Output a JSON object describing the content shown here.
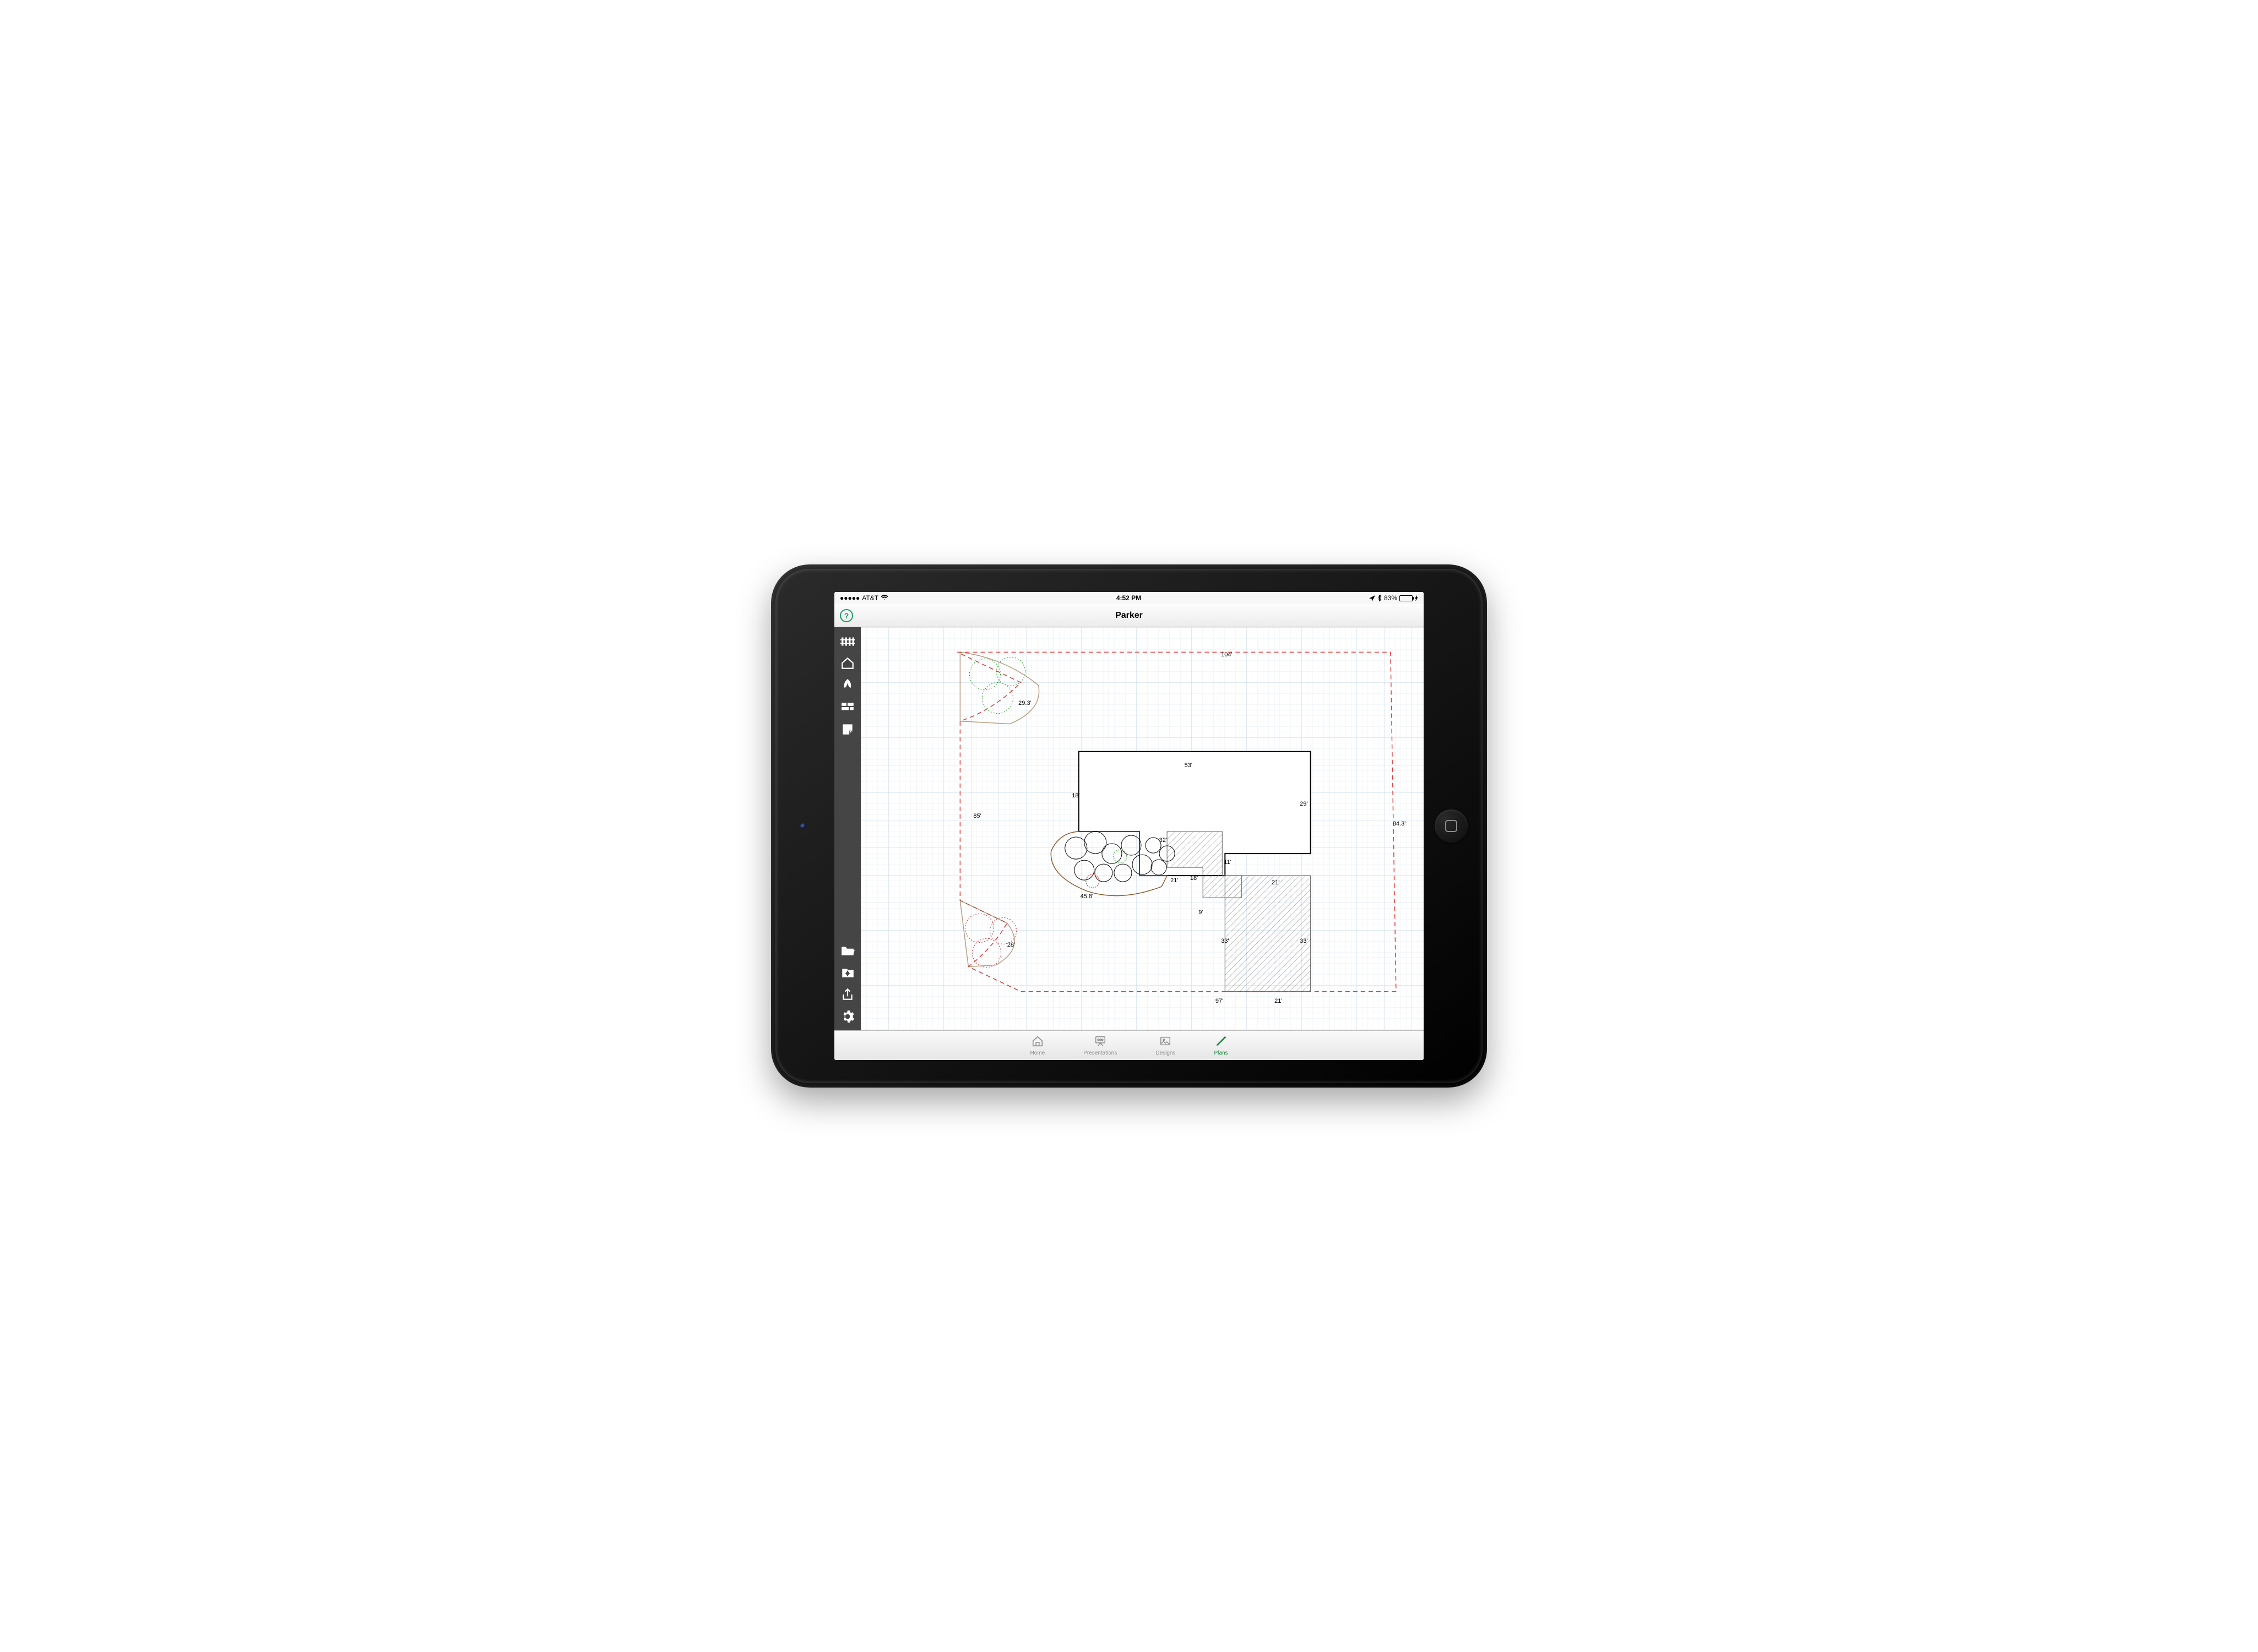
{
  "status": {
    "carrier": "AT&T",
    "signal_dots": "●●●●●",
    "time": "4:52 PM",
    "battery_pct": "83%",
    "nav_icon": "navigation-icon",
    "bt_icon": "bluetooth-icon",
    "wifi_icon": "wifi-icon",
    "charging_icon": "lightning-icon"
  },
  "header": {
    "title": "Parker",
    "help_glyph": "?"
  },
  "sidebar": {
    "tools": [
      {
        "name": "fence-tool-icon"
      },
      {
        "name": "house-tool-icon"
      },
      {
        "name": "plant-tool-icon"
      },
      {
        "name": "hardscape-tool-icon"
      },
      {
        "name": "note-tool-icon"
      }
    ],
    "actions": [
      {
        "name": "folder-open-icon"
      },
      {
        "name": "save-icon"
      },
      {
        "name": "share-icon"
      },
      {
        "name": "settings-icon"
      }
    ]
  },
  "tabs": [
    {
      "id": "home",
      "label": "Home",
      "active": false
    },
    {
      "id": "presentations",
      "label": "Presentations",
      "active": false
    },
    {
      "id": "designs",
      "label": "Designs",
      "active": false
    },
    {
      "id": "plans",
      "label": "Plans",
      "active": true
    }
  ],
  "plan": {
    "lot_dimensions": {
      "top": "104'",
      "right": "84.3'",
      "bottom_left": "97'",
      "bottom_right": "21'",
      "left": "85'",
      "upper_left_diag": "29.3'",
      "lower_left_diag": "28'"
    },
    "house_dimensions": {
      "top": "53'",
      "right_upper": "29'",
      "right_inset": "21'",
      "inset_height": "11'",
      "left": "18'",
      "bottom_bump": "32'",
      "under_bump_left": "18'",
      "under_bump_height": "9'",
      "garden_curve": "45.8'",
      "porch_short": "21'"
    },
    "driveway": {
      "left_height": "33'",
      "right_height": "33'"
    }
  }
}
